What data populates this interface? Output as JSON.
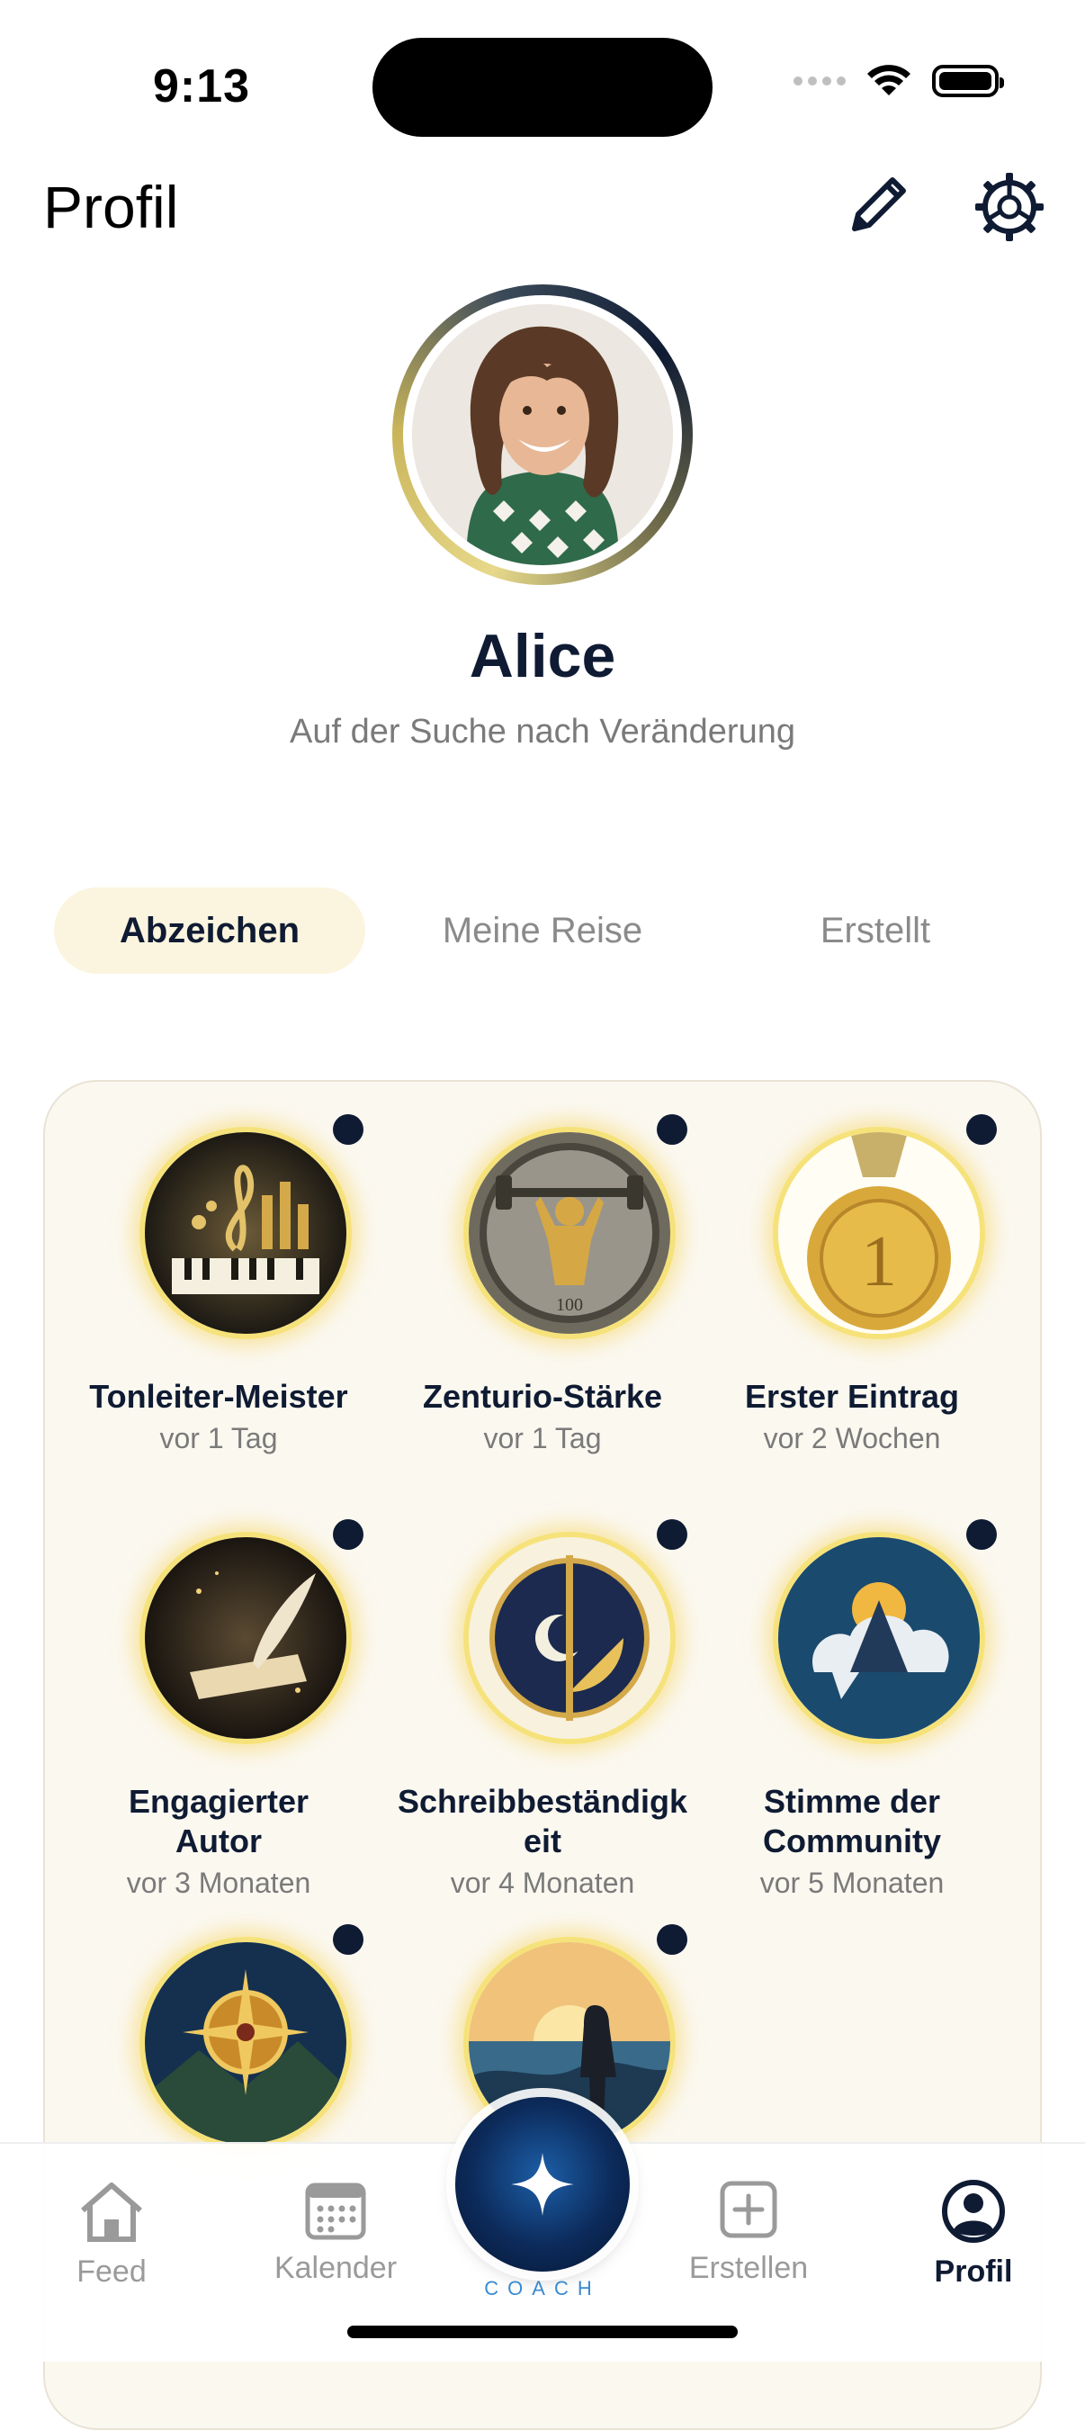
{
  "status": {
    "time": "9:13"
  },
  "header": {
    "title": "Profil",
    "edit_icon": "pencil-icon",
    "settings_icon": "gear-icon"
  },
  "profile": {
    "name": "Alice",
    "bio": "Auf der Suche nach Veränderung"
  },
  "tabs": [
    {
      "label": "Abzeichen",
      "active": true
    },
    {
      "label": "Meine Reise",
      "active": false
    },
    {
      "label": "Erstellt",
      "active": false
    }
  ],
  "badges": [
    {
      "name": "Tonleiter-Meister",
      "date": "vor 1 Tag",
      "icon": "treble-clef-piano-badge"
    },
    {
      "name": "Zenturio-Stärke",
      "date": "vor 1 Tag",
      "icon": "weightlifter-100-coin-badge"
    },
    {
      "name": "Erster Eintrag",
      "date": "vor 2 Wochen",
      "icon": "gold-medal-1-badge"
    },
    {
      "name": "Engagierter Autor",
      "date": "vor 3 Monaten",
      "icon": "quill-scroll-badge"
    },
    {
      "name": "Schreibbeständigkeit",
      "date": "vor 4 Monaten",
      "icon": "pen-moon-sun-badge"
    },
    {
      "name": "Stimme der Community",
      "date": "vor 5 Monaten",
      "icon": "speech-bubble-mountains-badge"
    },
    {
      "name": "",
      "date": "",
      "icon": "compass-mountains-badge"
    },
    {
      "name": "",
      "date": "",
      "icon": "hiker-sunrise-badge"
    }
  ],
  "nav": {
    "feed": "Feed",
    "calendar": "Kalender",
    "coach": "COACH",
    "create": "Erstellen",
    "profile": "Profil"
  },
  "colors": {
    "accent": "#0f1b33",
    "tab_active_bg": "#fbf5df",
    "badge_glow": "#f6e27a",
    "panel_bg": "#fbf8f0"
  }
}
